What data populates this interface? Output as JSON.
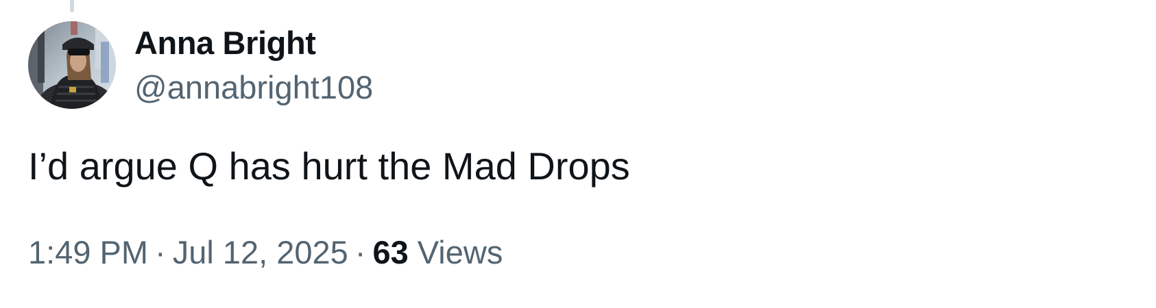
{
  "tweet": {
    "author": {
      "display_name": "Anna Bright",
      "handle": "@annabright108"
    },
    "text": "I’d argue Q has hurt the Mad Drops",
    "time": "1:49 PM",
    "separator": "·",
    "date": "Jul 12, 2025",
    "views_count": "63",
    "views_label": "Views"
  },
  "colors": {
    "primary_text": "#0f1419",
    "secondary_text": "#536471",
    "thread_line": "#cfd9de",
    "background": "#ffffff"
  },
  "icons": {
    "avatar": "user-photo-avatar"
  }
}
